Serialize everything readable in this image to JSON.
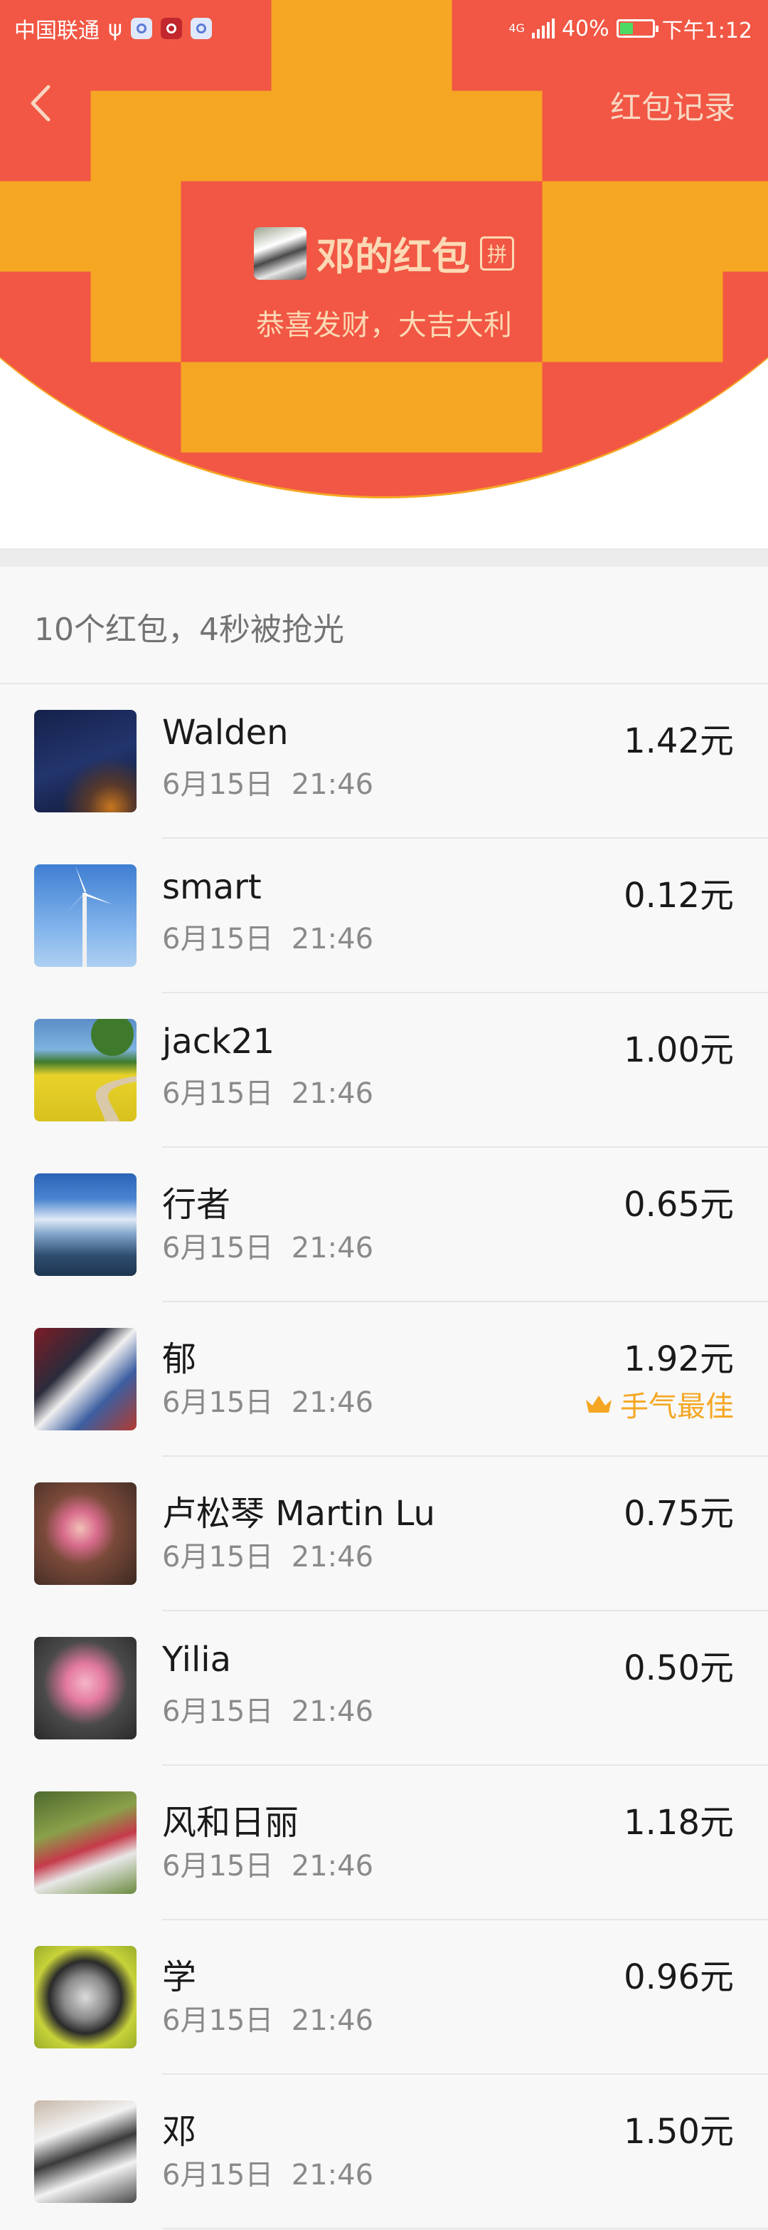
{
  "status_bar": {
    "carrier": "中国联通",
    "usb": "ψ",
    "network": "4G",
    "battery": "40%",
    "battery_level": 0.4,
    "time": "下午1:12"
  },
  "header": {
    "records_link": "红包记录",
    "sender_title": "邓的红包",
    "pin_badge": "拼",
    "greeting": "恭喜发财，大吉大利"
  },
  "summary": "10个红包，4秒被抢光",
  "colors": {
    "header_red": "#f15744",
    "header_text": "#fcd9b4",
    "best_luck": "#f5a623"
  },
  "records": [
    {
      "name": "Walden",
      "time": "6月15日  21:46",
      "amount": "1.42元"
    },
    {
      "name": "smart",
      "time": "6月15日  21:46",
      "amount": "0.12元"
    },
    {
      "name": "jack21",
      "time": "6月15日  21:46",
      "amount": "1.00元"
    },
    {
      "name": "行者",
      "time": "6月15日  21:46",
      "amount": "0.65元"
    },
    {
      "name": "郁",
      "time": "6月15日  21:46",
      "amount": "1.92元",
      "best": "手气最佳"
    },
    {
      "name": "卢松琴 Martin Lu",
      "time": "6月15日  21:46",
      "amount": "0.75元"
    },
    {
      "name": "Yilia",
      "time": "6月15日  21:46",
      "amount": "0.50元"
    },
    {
      "name": "风和日丽",
      "time": "6月15日  21:46",
      "amount": "1.18元"
    },
    {
      "name": "学",
      "time": "6月15日  21:46",
      "amount": "0.96元"
    },
    {
      "name": "邓",
      "time": "6月15日  21:46",
      "amount": "1.50元"
    }
  ]
}
